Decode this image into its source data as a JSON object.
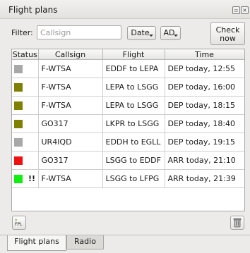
{
  "window": {
    "title": "Flight plans"
  },
  "filter": {
    "label": "Filter:",
    "placeholder": "Callsign",
    "sort_label": "Date",
    "type_label": "AD",
    "check_now_label": "Check now"
  },
  "table": {
    "columns": [
      "Status",
      "Callsign",
      "Flight",
      "Time"
    ],
    "rows": [
      {
        "status_color": "#a8a8a8",
        "flag": "",
        "callsign": "F-WTSA",
        "flight": "EDDF to LEPA",
        "time": "DEP today, 12:55"
      },
      {
        "status_color": "#808000",
        "flag": "",
        "callsign": "F-WTSA",
        "flight": "LEPA to LSGG",
        "time": "DEP today, 16:00"
      },
      {
        "status_color": "#808000",
        "flag": "",
        "callsign": "F-WTSA",
        "flight": "LEPA to LSGG",
        "time": "DEP today, 18:15"
      },
      {
        "status_color": "#808000",
        "flag": "",
        "callsign": "GO317",
        "flight": "LKPR to LSGG",
        "time": "DEP today, 18:40"
      },
      {
        "status_color": "#a8a8a8",
        "flag": "",
        "callsign": "UR4IQD",
        "flight": "EDDH to EGLL",
        "time": "DEP today, 19:15"
      },
      {
        "status_color": "#ee1111",
        "flag": "",
        "callsign": "GO317",
        "flight": "LSGG to EDDF",
        "time": "ARR today, 21:10"
      },
      {
        "status_color": "#11ee11",
        "flag": "!!",
        "callsign": "F-WTSA",
        "flight": "LSGG to LFPG",
        "time": "ARR today, 21:39"
      }
    ]
  },
  "footer": {
    "fpl_icon_label": "FPL"
  },
  "tabs": [
    "Flight plans",
    "Radio"
  ]
}
